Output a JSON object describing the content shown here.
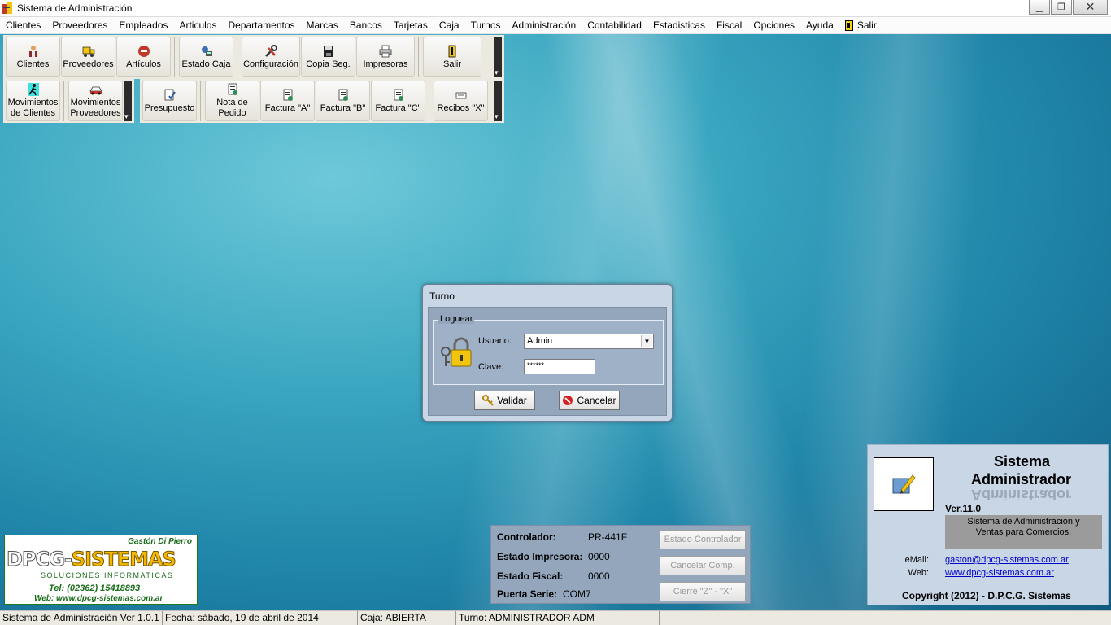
{
  "window": {
    "title": "Sistema de Administración"
  },
  "menu": [
    "Clientes",
    "Proveedores",
    "Empleados",
    "Articulos",
    "Departamentos",
    "Marcas",
    "Bancos",
    "Tarjetas",
    "Caja",
    "Turnos",
    "Administración",
    "Contabilidad",
    "Estadisticas",
    "Fiscal",
    "Opciones",
    "Ayuda",
    "Salir"
  ],
  "toolbar1": {
    "clientes": "Clientes",
    "proveedores": "Proveedores",
    "articulos": "Artículos",
    "estado_caja": "Estado Caja",
    "configuracion": "Configuración",
    "copia_seg": "Copia Seg.",
    "impresoras": "Impresoras",
    "salir": "Salir"
  },
  "toolbar2": {
    "mov_clientes_1": "Movimientos",
    "mov_clientes_2": "de Clientes",
    "mov_proveedores_1": "Movimientos",
    "mov_proveedores_2": "Proveedores"
  },
  "toolbar3": {
    "presupuesto": "Presupuesto",
    "nota_pedido_1": "Nota de",
    "nota_pedido_2": "Pedido",
    "factura_a": "Factura \"A\"",
    "factura_b": "Factura \"B\"",
    "factura_c": "Factura \"C\"",
    "recibos_x": "Recibos \"X\""
  },
  "dialog": {
    "title": "Turno",
    "group": "Loguear",
    "usuario_label": "Usuario:",
    "usuario_value": "Admin",
    "clave_label": "Clave:",
    "clave_value": "******",
    "validar": "Validar",
    "cancelar": "Cancelar"
  },
  "logo": {
    "author": "Gastón Di Pierro",
    "brand_a": "DPCG-",
    "brand_b": "SISTEMAS",
    "tagline": "SOLUCIONES INFORMATICAS",
    "tel": "Tel: (02362) 15418893",
    "web": "Web: www.dpcg-sistemas.com.ar"
  },
  "fiscal": {
    "controlador_label": "Controlador:",
    "controlador_value": "PR-441F",
    "impresora_label": "Estado Impresora:",
    "impresora_value": "0000",
    "fiscal_label": "Estado Fiscal:",
    "fiscal_value": "0000",
    "puerta_label": "Puerta Serie:",
    "puerta_value": "COM7",
    "btn_estado": "Estado Controlador",
    "btn_cancelar": "Cancelar Comp.",
    "btn_cierre": "Cierre \"Z\" - \"X\""
  },
  "about": {
    "title1": "Sistema",
    "title2": "Administrador",
    "version": "Ver.11.0",
    "desc1": "Sistema de Administración y",
    "desc2": "Ventas  para Comercios.",
    "email_label": "eMail:",
    "email": "gaston@dpcg-sistemas.com.ar",
    "web_label": "Web:",
    "web": "www.dpcg-sistemas.com.ar",
    "copyright": "Copyright (2012) - D.P.C.G. Sistemas"
  },
  "status": {
    "version": "Sistema de Administración Ver 1.0.1",
    "fecha": "Fecha: sábado, 19 de abril de 2014",
    "caja": "Caja: ABIERTA",
    "turno": "Turno: ADMINISTRADOR ADM"
  }
}
